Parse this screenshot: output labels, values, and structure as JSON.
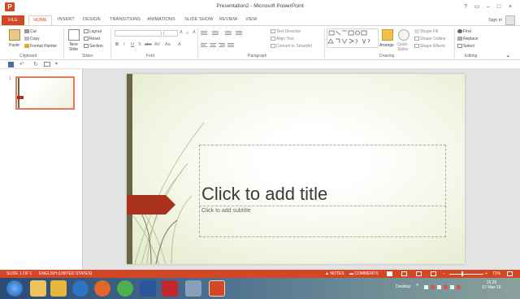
{
  "titlebar": {
    "app_icon": "P",
    "title": "Presentation2 - Microsoft PowerPoint",
    "help": "?",
    "restore_ribbon": "▭",
    "minimize": "–",
    "maximize": "□",
    "close": "×"
  },
  "tabs": {
    "file": "FILE",
    "home": "HOME",
    "insert": "INSERT",
    "design": "DESIGN",
    "transitions": "TRANSITIONS",
    "animations": "ANIMATIONS",
    "slideshow": "SLIDE SHOW",
    "review": "REVIEW",
    "view": "VIEW",
    "signin": "Sign in"
  },
  "ribbon": {
    "clipboard": {
      "paste": "Paste",
      "cut": "Cut",
      "copy": "Copy",
      "format_painter": "Format Painter",
      "label": "Clipboard"
    },
    "slides": {
      "new_slide_1": "New",
      "new_slide_2": "Slide",
      "layout": "Layout",
      "reset": "Reset",
      "section": "Section",
      "label": "Slides"
    },
    "font": {
      "bold": "B",
      "italic": "I",
      "underline": "U",
      "strike": "S",
      "abc": "abc",
      "av": "AV",
      "aa": "Aa",
      "grow": "A",
      "shrink": "A",
      "clear": "A",
      "color": "A",
      "label": "Font"
    },
    "paragraph": {
      "text_direction": "Text Direction",
      "align_text": "Align Text",
      "convert_smartart": "Convert to SmartArt",
      "label": "Paragraph"
    },
    "drawing": {
      "arrange": "Arrange",
      "quick_styles_1": "Quick",
      "quick_styles_2": "Styles",
      "shape_fill": "Shape Fill",
      "shape_outline": "Shape Outline",
      "shape_effects": "Shape Effects",
      "label": "Drawing"
    },
    "editing": {
      "find": "Find",
      "replace": "Replace",
      "select": "Select",
      "label": "Editing"
    }
  },
  "thumbnails": {
    "slide_number": "1"
  },
  "slide": {
    "title_placeholder": "Click to add title",
    "subtitle_placeholder": "Click to add subtitle"
  },
  "statusbar": {
    "slide_info": "SLIDE 1 OF 1",
    "language": "ENGLISH (UNITED STATES)",
    "notes": "NOTES",
    "comments": "COMMENTS",
    "zoom": "71%"
  },
  "taskbar": {
    "desktop_label": "Desktop",
    "time": "15:26",
    "date": "07-Mar-16"
  },
  "colors": {
    "accent": "#d24726",
    "slide_bar": "#6b6547",
    "slide_arrow": "#a8321c"
  }
}
